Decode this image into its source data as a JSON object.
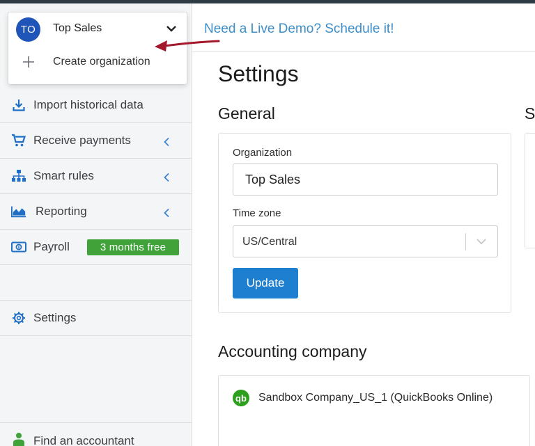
{
  "org_switcher": {
    "avatar_initials": "TO",
    "org_name": "Top Sales",
    "create_label": "Create organization"
  },
  "header": {
    "demo_link": "Need a Live Demo? Schedule it!"
  },
  "sidebar": {
    "items": [
      {
        "label": "Import historical data",
        "icon": "download-icon"
      },
      {
        "label": "Receive payments",
        "icon": "cart-icon",
        "expandable": true
      },
      {
        "label": "Smart rules",
        "icon": "hierarchy-icon",
        "expandable": true
      },
      {
        "label": "Reporting",
        "icon": "area-chart-icon",
        "expandable": true
      },
      {
        "label": "Payroll",
        "icon": "money-icon",
        "badge": "3 months free"
      },
      {
        "label": "Settings",
        "icon": "gear-icon"
      },
      {
        "label": "Find an accountant",
        "icon": "person-icon"
      }
    ]
  },
  "main": {
    "page_title": "Settings",
    "general": {
      "title": "General",
      "organization_label": "Organization",
      "organization_value": "Top Sales",
      "timezone_label": "Time zone",
      "timezone_value": "US/Central",
      "update_label": "Update"
    },
    "second_section_title_partial": "S",
    "accounting": {
      "title": "Accounting company",
      "company": "Sandbox Company_US_1 (QuickBooks Online)",
      "logo_text": "qb"
    }
  },
  "colors": {
    "accent_blue": "#1e7fd0",
    "link_blue": "#3d8ec9",
    "avatar_blue": "#1f55b8",
    "badge_green": "#3fa33a",
    "qb_green": "#2ca01c",
    "annotation_red": "#a3182b"
  }
}
